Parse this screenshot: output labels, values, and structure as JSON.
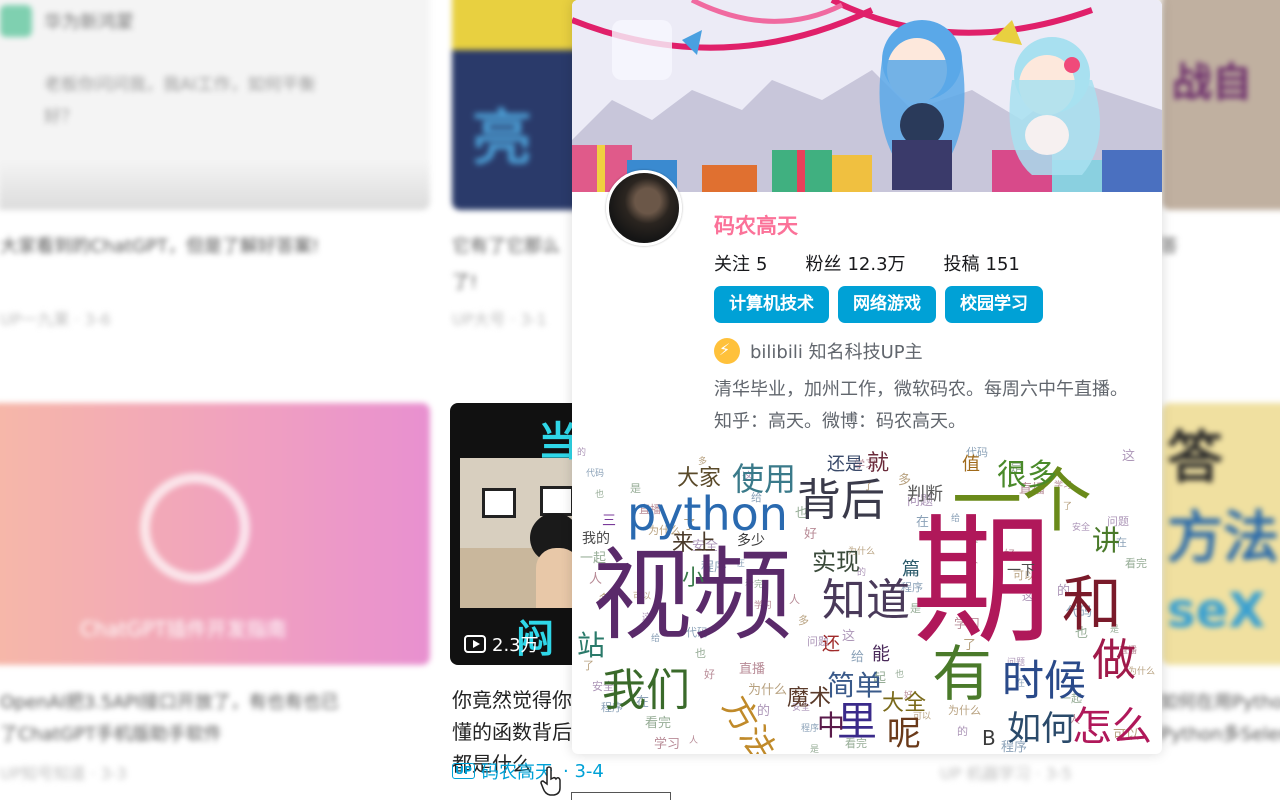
{
  "popup": {
    "username": "码农高天",
    "stats": [
      {
        "label": "关注",
        "value": "5"
      },
      {
        "label": "粉丝",
        "value": "12.3万"
      },
      {
        "label": "投稿",
        "value": "151"
      }
    ],
    "tags": [
      "计算机技术",
      "网络游戏",
      "校园学习"
    ],
    "verify_text": "bilibili 知名科技UP主",
    "bio": "清华毕业，加州工作，微软码农。每周六中午直播。知乎：高天。微博：码农高天。"
  },
  "video_card": {
    "view_count": "2.3万",
    "title": "你竟然觉得你懂的函数背后都是什么",
    "up_badge": "UP",
    "uploader": "码农高天",
    "date": "· 3-4",
    "thumb_top_text": "当",
    "thumb_bottom_text": "闷"
  },
  "background": {
    "card1_title": "华为新鸿蒙",
    "card1_desc1": "老板你问问我，我AI工作，如何平衡",
    "card1_desc2": "好？",
    "row1_title1": "大家看到的ChatGPT，但是了解好答案!",
    "row1_title2": "它有了它那么",
    "row1_title2b": "了!",
    "row1_meta1": "UP一九果 · 3-6",
    "row1_meta2": "UP大号 · 3-1",
    "row1_right": "答",
    "chatgpt_label": "ChatGPT插件开发指南",
    "row2_title1": "OpenAI把3.5API接口开放了，有也有也已",
    "row2_title1b": "了ChatGPT手机版助手软件",
    "row2_meta1": "UP知号知道 · 3-3",
    "row2_right1": "如何在用Python",
    "row2_right2": "Python多Selenium",
    "row2_right_meta": "UP 机器学习 · 3-5"
  },
  "wordcloud": [
    {
      "t": "期",
      "color": "#b0185a"
    },
    {
      "t": "视频",
      "color": "#5a2a6a"
    },
    {
      "t": "一个",
      "color": "#6a8a1a"
    },
    {
      "t": "python",
      "color": "#2a6ab0"
    },
    {
      "t": "和",
      "color": "#7a1a2a"
    },
    {
      "t": "有",
      "color": "#4a7a2a"
    },
    {
      "t": "知道",
      "color": "#4a3a5a"
    },
    {
      "t": "背后",
      "color": "#3a3a4a"
    },
    {
      "t": "我们",
      "color": "#3a6a2a"
    },
    {
      "t": "时候",
      "color": "#2a4a8a"
    },
    {
      "t": "做",
      "color": "#a01a4a"
    },
    {
      "t": "怎么",
      "color": "#b0185a"
    },
    {
      "t": "里",
      "color": "#3a2a8a"
    },
    {
      "t": "呢",
      "color": "#6a3a1a"
    },
    {
      "t": "如何",
      "color": "#2a4a6a"
    },
    {
      "t": "方法",
      "color": "#c08a2a"
    },
    {
      "t": "简单",
      "color": "#3a5a8a"
    },
    {
      "t": "使用",
      "color": "#3a7a8a"
    },
    {
      "t": "很多",
      "color": "#4a8a2a"
    },
    {
      "t": "大家",
      "color": "#5a4a2a"
    },
    {
      "t": "站",
      "color": "#2a7a6a"
    },
    {
      "t": "讲",
      "color": "#4a7a2a"
    },
    {
      "t": "魔术",
      "color": "#5a3a2a"
    },
    {
      "t": "实现",
      "color": "#3a4a3a"
    },
    {
      "t": "大全",
      "color": "#7a6a1a"
    },
    {
      "t": "中",
      "color": "#5a1a4a"
    },
    {
      "t": "来上",
      "color": "#4a3a2a"
    },
    {
      "t": "小",
      "color": "#3a7a4a"
    },
    {
      "t": "就",
      "color": "#6a2a3a"
    },
    {
      "t": "还是",
      "color": "#3a4a6a"
    },
    {
      "t": "能",
      "color": "#4a2a5a"
    },
    {
      "t": "判断",
      "color": "#5a5a5a"
    },
    {
      "t": "值",
      "color": "#a06a1a"
    },
    {
      "t": "B",
      "color": "#3a3a3a"
    },
    {
      "t": "还",
      "color": "#a02a2a"
    },
    {
      "t": "篇",
      "color": "#2a5a6a"
    },
    {
      "t": "三",
      "color": "#7a3a9a"
    },
    {
      "t": "多少",
      "color": "#3a3a3a"
    },
    {
      "t": "我的",
      "color": "#4a4a4a"
    },
    {
      "t": "一下",
      "color": "#4a4a4a"
    }
  ]
}
